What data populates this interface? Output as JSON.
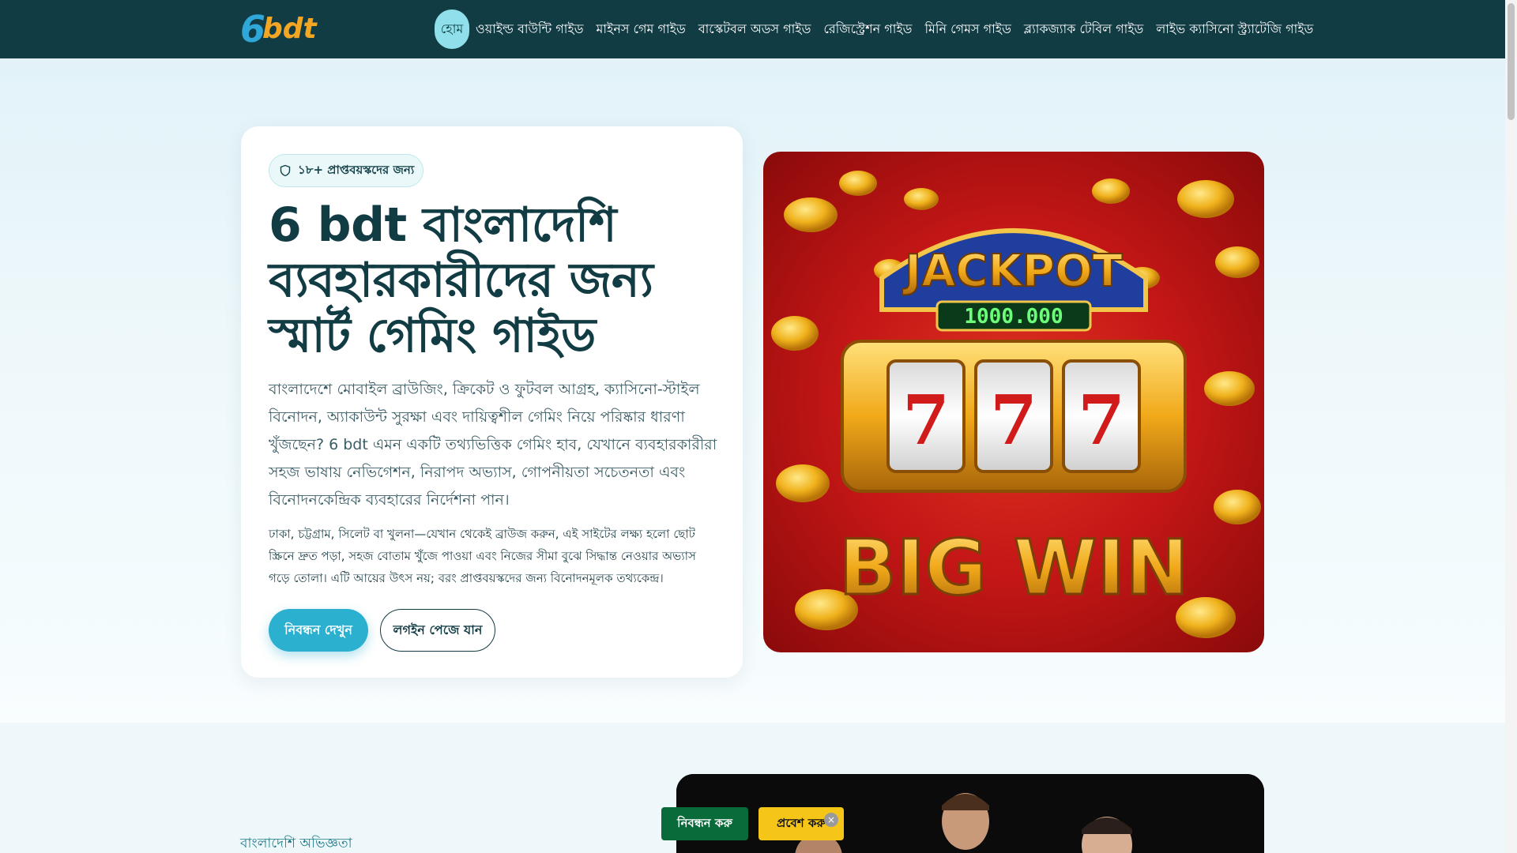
{
  "header": {
    "logo_six": "6",
    "logo_bdt": "bdt",
    "nav": [
      {
        "label": "হোম",
        "active": true
      },
      {
        "label": "ওয়াইল্ড বাউন্টি গাইড"
      },
      {
        "label": "মাইনস গেম গাইড"
      },
      {
        "label": "বাস্কেটবল অডস গাইড"
      },
      {
        "label": "রেজিস্ট্রেশন গাইড"
      },
      {
        "label": "মিনি গেমস গাইড"
      },
      {
        "label": "ব্ল্যাকজ্যাক টেবিল গাইড"
      },
      {
        "label": "লাইভ ক্যাসিনো স্ট্র্যাটেজি গাইড"
      }
    ]
  },
  "hero": {
    "badge": "১৮+ প্রাপ্তবয়স্কদের জন্য",
    "title": "6 bdt বাংলাদেশি ব্যবহারকারীদের জন্য স্মার্ট গেমিং গাইড",
    "lead": "বাংলাদেশে মোবাইল ব্রাউজিং, ক্রিকেট ও ফুটবল আগ্রহ, ক্যাসিনো-স্টাইল বিনোদন, অ্যাকাউন্ট সুরক্ষা এবং দায়িত্বশীল গেমিং নিয়ে পরিষ্কার ধারণা খুঁজছেন? 6 bdt এমন একটি তথ্যভিত্তিক গেমিং হাব, যেখানে ব্যবহারকারীরা সহজ ভাষায় নেভিগেশন, নিরাপদ অভ্যাস, গোপনীয়তা সচেতনতা এবং বিনোদনকেন্দ্রিক ব্যবহারের নির্দেশনা পান।",
    "small": "ঢাকা, চট্টগ্রাম, সিলেট বা খুলনা—যেখান থেকেই ব্রাউজ করুন, এই সাইটের লক্ষ্য হলো ছোট স্ক্রিনে দ্রুত পড়া, সহজ বোতাম খুঁজে পাওয়া এবং নিজের সীমা বুঝে সিদ্ধান্ত নেওয়ার অভ্যাস গড়ে তোলা। এটি আয়ের উৎস নয়; বরং প্রাপ্তবয়স্কদের জন্য বিনোদনমূলক তথ্যকেন্দ্র।",
    "btn_primary": "নিবন্ধন দেখুন",
    "btn_outline": "লগইন পেজে যান"
  },
  "hero_image": {
    "jackpot_word": "JACKPOT",
    "jackpot_value": "1000.000",
    "reels": [
      "7",
      "7",
      "7"
    ],
    "big_win": "BIG WIN"
  },
  "section2": {
    "label": "বাংলাদেশি অভিজ্ঞতা"
  },
  "sticky": {
    "register": "নিবন্ধন করু",
    "login": "প্রবেশ করু",
    "close": "×"
  },
  "colors": {
    "header_bg": "#123c44",
    "accent": "#2bb0d0",
    "nav_active_bg": "#8fe0ea",
    "sticky_register": "#0a6b3a",
    "sticky_login": "#f5c518"
  }
}
